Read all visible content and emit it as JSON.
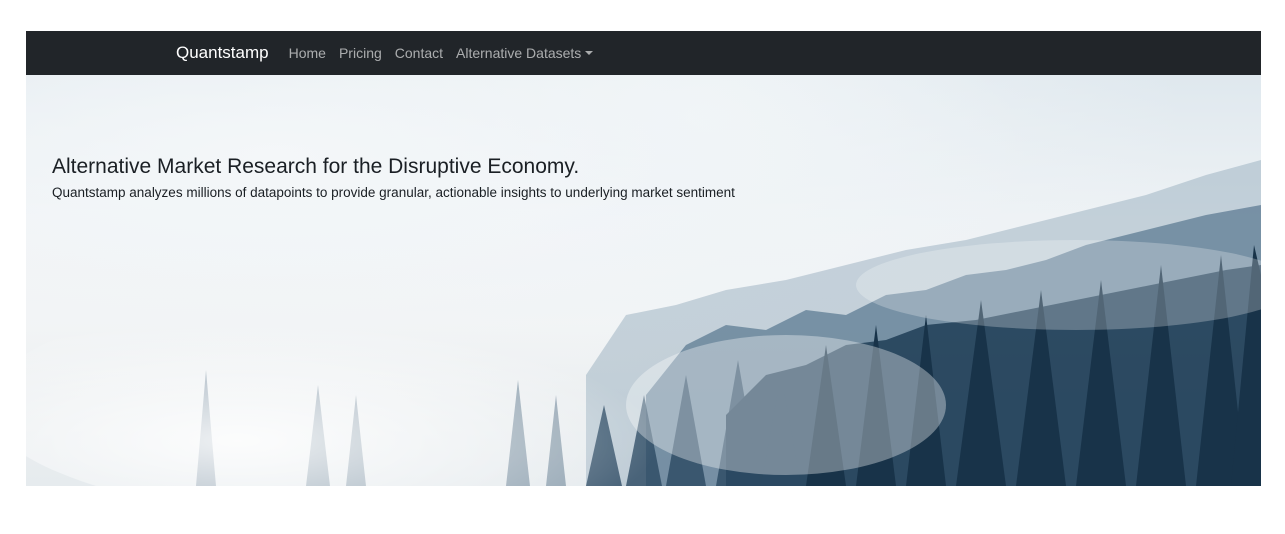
{
  "navbar": {
    "brand": "Quantstamp",
    "links": [
      {
        "label": "Home"
      },
      {
        "label": "Pricing"
      },
      {
        "label": "Contact"
      }
    ],
    "dropdown": {
      "label": "Alternative Datasets",
      "icon": "caret-down-icon"
    }
  },
  "hero": {
    "title": "Alternative Market Research for the Disruptive Economy.",
    "subtitle": "Quantstamp analyzes millions of datapoints to provide granular, actionable insights to underlying market sentiment",
    "background": "misty-forest-image"
  },
  "colors": {
    "navbar_bg": "#212529",
    "brand_text": "#ffffff",
    "nav_link_text": "#9fa2a5",
    "hero_text": "#1a1f24"
  }
}
